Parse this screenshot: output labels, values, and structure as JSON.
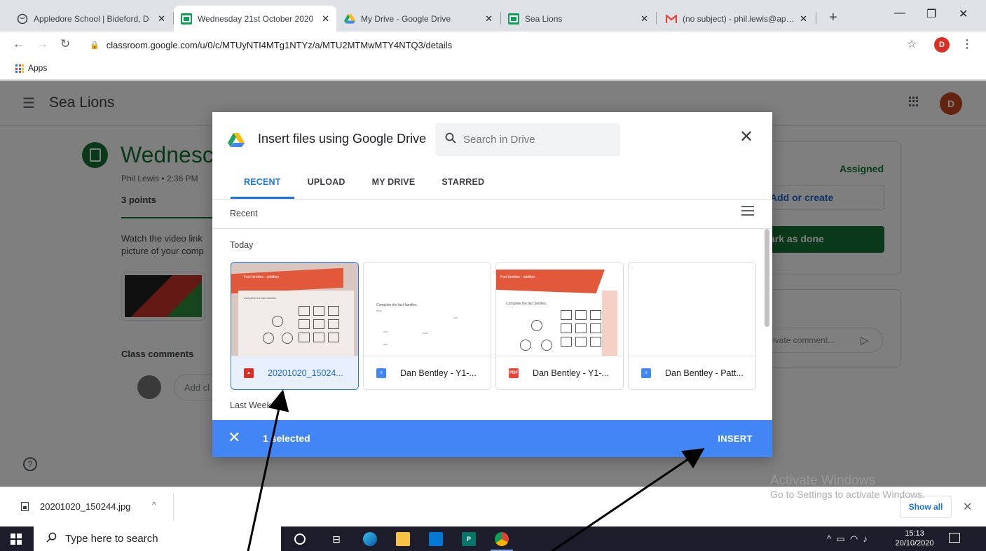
{
  "browser": {
    "tabs": [
      {
        "title": "Appledore School | Bideford, D",
        "favicon": "globe-icon",
        "active": false
      },
      {
        "title": "Wednesday 21st October 2020",
        "favicon": "classroom-icon",
        "active": true
      },
      {
        "title": "My Drive - Google Drive",
        "favicon": "drive-icon",
        "active": false
      },
      {
        "title": "Sea Lions",
        "favicon": "classroom-icon",
        "active": false
      },
      {
        "title": "(no subject) - phil.lewis@apple",
        "favicon": "gmail-icon",
        "active": false
      }
    ],
    "url": "classroom.google.com/u/0/c/MTUyNTI4MTg1NTYz/a/MTU2MTMwMTY4NTQ3/details",
    "profile_initial": "D",
    "bookmarks": [
      {
        "label": "Apps",
        "icon": "apps-grid-icon"
      }
    ]
  },
  "classroom": {
    "class_name": "Sea Lions",
    "avatar_initial": "D",
    "assignment": {
      "title": "Wednesc",
      "meta": "Phil Lewis • 2:36 PM",
      "points": "3 points",
      "description_line1": "Watch the video link",
      "description_line2": "picture of your comp",
      "class_comments": "Class comments",
      "add_comment_placeholder": "Add cl"
    },
    "your_work": {
      "status": "Assigned",
      "add_or_create": "Add or create",
      "mark_as_done": "ark as done"
    },
    "private_comments": {
      "title": "ents",
      "placeholder": "rivate comment..."
    }
  },
  "picker": {
    "title": "Insert files using Google Drive",
    "search_placeholder": "Search in Drive",
    "tabs": [
      {
        "label": "RECENT",
        "active": true
      },
      {
        "label": "UPLOAD",
        "active": false
      },
      {
        "label": "MY DRIVE",
        "active": false
      },
      {
        "label": "STARRED",
        "active": false
      }
    ],
    "recent_heading": "Recent",
    "today_heading": "Today",
    "last_week_heading": "Last Week",
    "files": [
      {
        "name": "20201020_15024...",
        "type": "image",
        "selected": true
      },
      {
        "name": "Dan Bentley - Y1-...",
        "type": "doc",
        "selected": false
      },
      {
        "name": "Dan Bentley - Y1-...",
        "type": "pdf",
        "selected": false
      },
      {
        "name": "Dan Bentley - Patt...",
        "type": "doc",
        "selected": false
      }
    ],
    "thumb_text": {
      "fact_families": "Fact families - addition",
      "complete": "Complete the fact families.",
      "pdf_badge": "PDF"
    },
    "selection_text": "1 selected",
    "insert_label": "INSERT"
  },
  "downloads": {
    "file_name": "20201020_150244.jpg",
    "show_all": "Show all"
  },
  "watermark": {
    "line1": "Activate Windows",
    "line2": "Go to Settings to activate Windows."
  },
  "taskbar": {
    "search_placeholder": "Type here to search",
    "time": "15:13",
    "date": "20/10/2020"
  },
  "colors": {
    "classroom_green": "#137333",
    "picker_blue": "#4285f4",
    "selected_tint": "#e8f0fe"
  }
}
